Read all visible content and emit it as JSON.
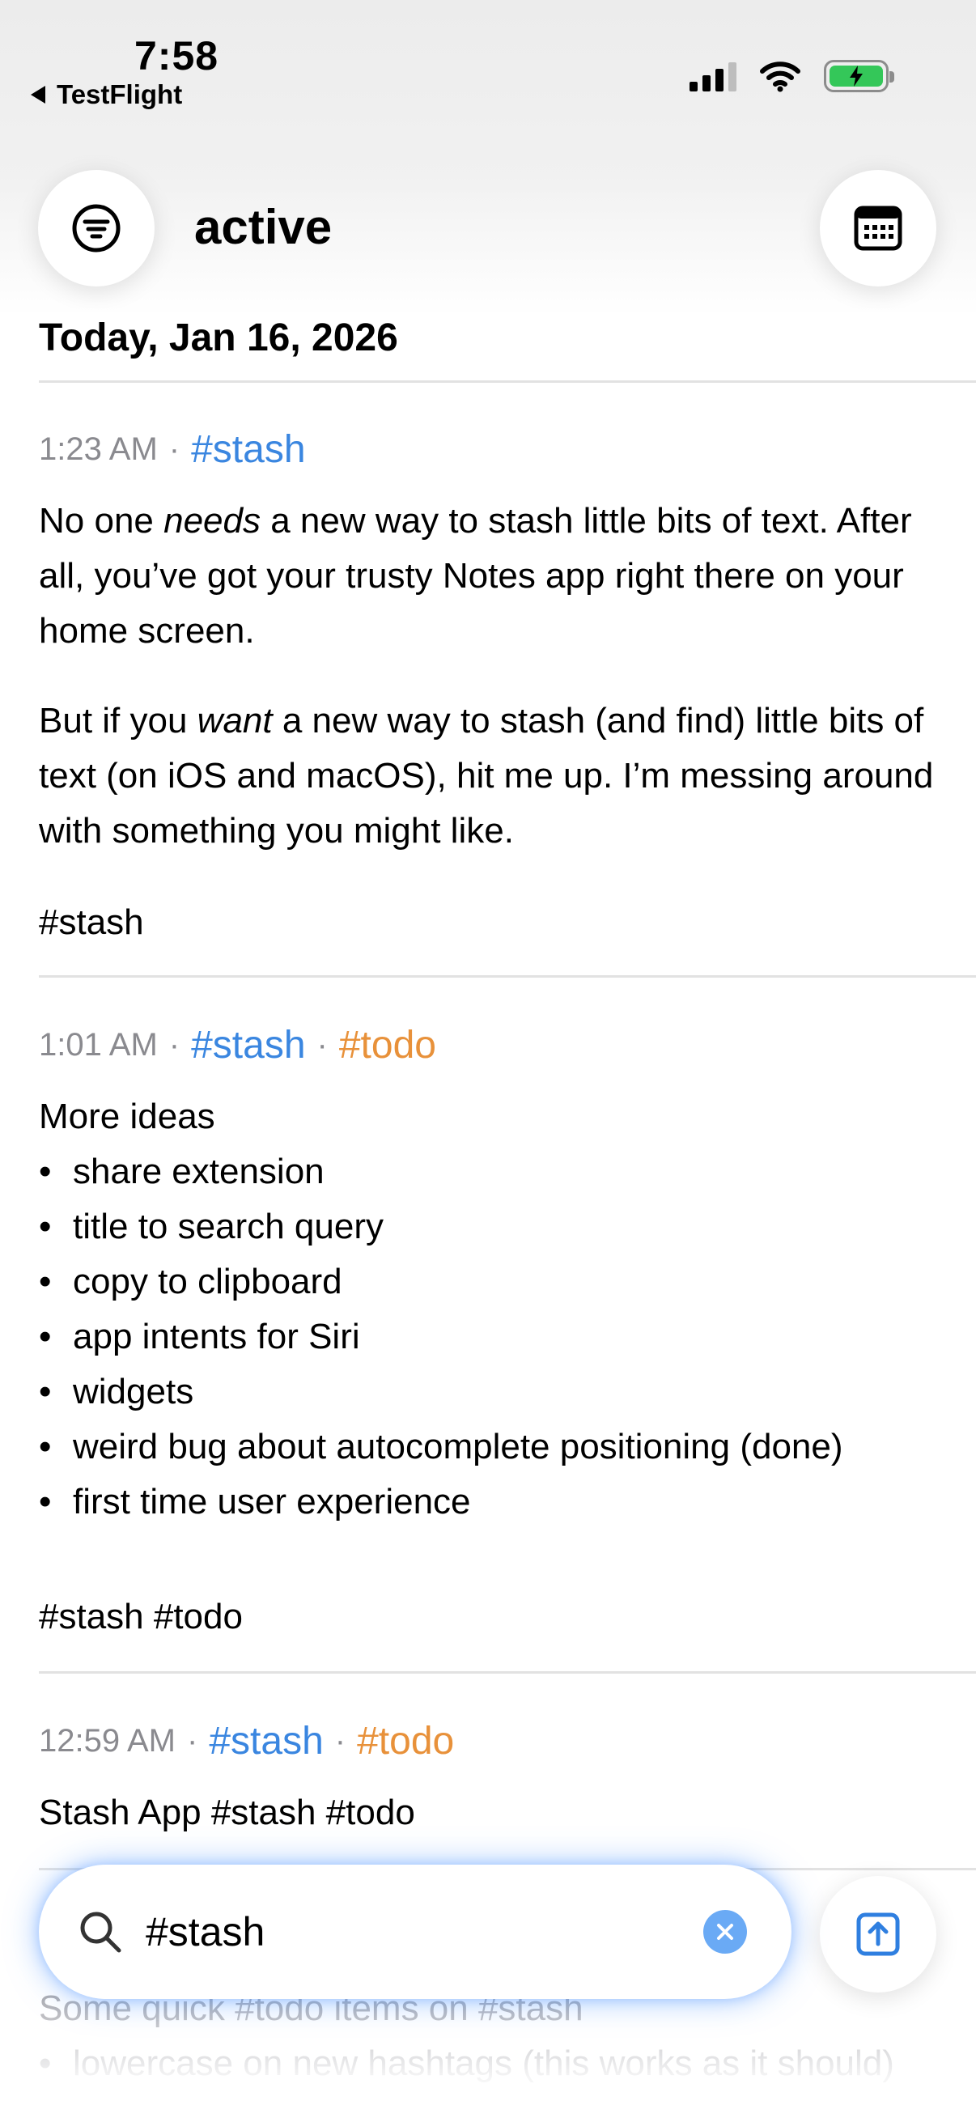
{
  "status_bar": {
    "time": "7:58",
    "back_label": "TestFlight"
  },
  "header": {
    "title": "active"
  },
  "day_heading": "Today, Jan 16, 2026",
  "entries": [
    {
      "time": "1:23 AM",
      "tags": [
        "#stash"
      ],
      "paragraphs": [
        {
          "pre": "No one ",
          "em": "needs",
          "post": " a new way to stash little bits of text. After all, you’ve got your trusty Notes app right there on your home screen."
        },
        {
          "pre": "But if you ",
          "em": "want",
          "post": " a new way to stash (and find) little bits of text (on iOS and macOS), hit me up. I’m messing around with something you might like."
        }
      ],
      "footer": "#stash"
    },
    {
      "time": "1:01 AM",
      "tags": [
        "#stash",
        "#todo"
      ],
      "heading": "More ideas",
      "bullets": [
        "share extension",
        "title to search query",
        "copy to clipboard",
        "app intents for Siri",
        "widgets",
        "weird bug about autocomplete positioning (done)",
        "first time user experience"
      ],
      "footer": "#stash #todo"
    },
    {
      "time": "12:59 AM",
      "tags": [
        "#stash",
        "#todo"
      ],
      "body": "Stash App #stash #todo"
    },
    {
      "body": "Some quick #todo items on #stash",
      "bullets": [
        "lowercase on new hashtags (this works as it should)"
      ]
    }
  ],
  "search": {
    "value": "#stash"
  },
  "icons": {
    "filter": "filter-icon",
    "calendar": "calendar-icon",
    "search": "search-icon",
    "clear": "clear-icon",
    "share": "share-icon"
  },
  "colors": {
    "tag_stash": "#3a86e0",
    "tag_todo": "#e8913a",
    "search_glow": "#6aaaf5",
    "battery": "#34c759"
  }
}
